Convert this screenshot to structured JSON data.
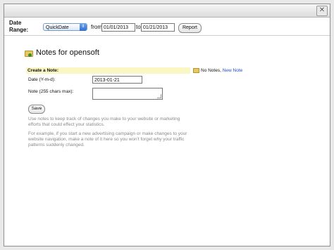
{
  "window": {
    "close_glyph": "✕"
  },
  "toolbar": {
    "date_range_label_line1": "Date",
    "date_range_label_line2": "Range:",
    "quickdate_selected": "QuickDate",
    "from_label": "from",
    "from_date": "01/01/2013",
    "to_label": "to",
    "to_date": "01/21/2013",
    "report_label": "Report"
  },
  "main": {
    "title": "Notes for opensoft",
    "create_note_header": "Create a Note:",
    "notes_status": "No Notes,",
    "new_note_link": "New Note",
    "date_label": "Date (Y-m-d):",
    "date_value": "2013-01-21",
    "note_label": "Note (255 chars max):",
    "note_value": "",
    "save_label": "Save",
    "help_paragraph_1": "Use notes to keep track of changes you make to your website or marketing efforts that could effect your statistics.",
    "help_paragraph_2": "For example, if you start a new advertising campaign or make changes to your website navigation, make a note of it here so you won't forget why your traffic patterns suddenly changed."
  },
  "icons": {
    "title_icon": "folder-add-icon",
    "new_note_icon": "folder-add-icon",
    "select_arrow": "updown-arrow-icon"
  },
  "colors": {
    "create_bar_bg": "#fbf7c4",
    "link": "#1f4fcc",
    "help_text": "#8a8a8a"
  }
}
